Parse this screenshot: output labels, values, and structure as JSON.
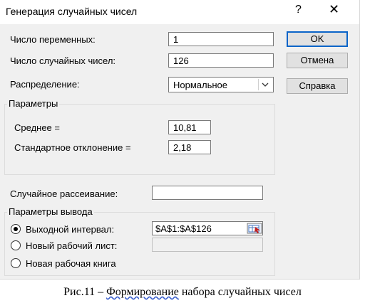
{
  "dialog": {
    "title": "Генерация случайных чисел",
    "help_glyph": "?",
    "close_glyph": "✕"
  },
  "fields": {
    "variables_label": "Число переменных:",
    "variables_value": "1",
    "count_label": "Число случайных чисел:",
    "count_value": "126",
    "distribution_label": "Распределение:",
    "distribution_value": "Нормальное"
  },
  "buttons": {
    "ok": "OK",
    "cancel": "Отмена",
    "help": "Справка"
  },
  "parameters": {
    "title": "Параметры",
    "mean_label": "Среднее =",
    "mean_value": "10,81",
    "std_label": "Стандартное отклонение =",
    "std_value": "2,18"
  },
  "seed": {
    "label": "Случайное рассеивание:",
    "value": ""
  },
  "output": {
    "title": "Параметры вывода",
    "range_label": "Выходной интервал:",
    "range_value": "$A$1:$A$126",
    "new_sheet_label": "Новый рабочий лист:",
    "new_book_label": "Новая рабочая книга"
  },
  "caption": {
    "prefix": "Рис.11 – ",
    "underlined": "Формирование",
    "suffix": " набора случайных чисел"
  },
  "colors": {
    "dialog_bg": "#f0f0f0",
    "default_button_border": "#0a64c8"
  },
  "icons": [
    "help-icon",
    "close-icon",
    "chevron-down-icon",
    "range-select-icon"
  ]
}
